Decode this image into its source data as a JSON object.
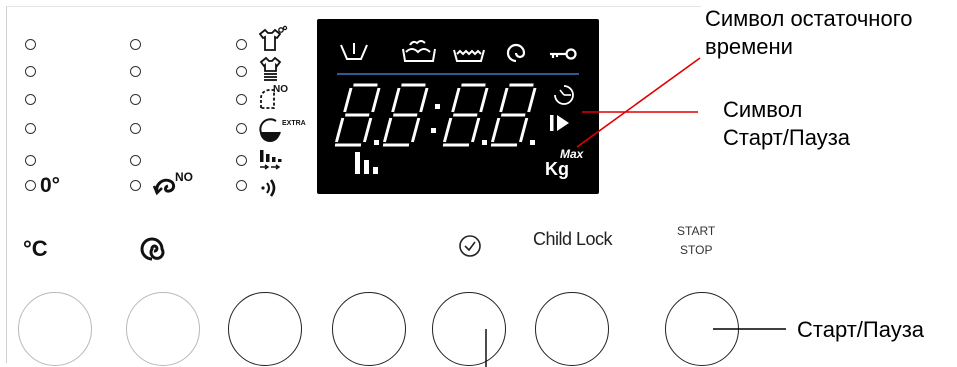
{
  "panel": {
    "zero_degree_label": "0°",
    "no_spin_label": "NO",
    "temp_label": "°C",
    "child_lock_label": "Child Lock",
    "start_stop_label_line1": "START",
    "start_stop_label_line2": "STOP"
  },
  "display": {
    "digits": "8.8:8.8.",
    "no_badge": "NO",
    "extra_badge": "EXTRA",
    "max_label": "Max",
    "kg_label": "Kg"
  },
  "annotations": {
    "remaining_time_line1": "Символ остаточного",
    "remaining_time_line2": "времени",
    "start_pause_symbol_line1": "Символ",
    "start_pause_symbol_line2": "Старт/Пауза",
    "start_pause_button": "Старт/Пауза"
  },
  "colors": {
    "display_bg": "#000000",
    "display_fg": "#ffffff",
    "separator": "#3f78c8",
    "callout_line": "#e00000"
  }
}
